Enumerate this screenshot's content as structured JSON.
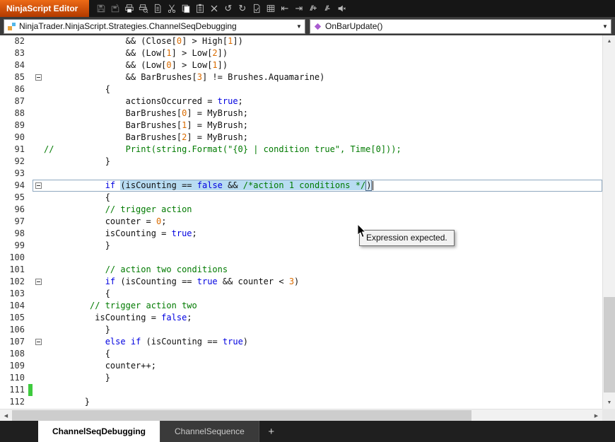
{
  "window": {
    "title": "NinjaScript Editor"
  },
  "toolbar": {
    "icons": [
      {
        "name": "save-icon",
        "disabled": true
      },
      {
        "name": "save-as-icon",
        "disabled": true
      },
      {
        "name": "print-icon",
        "disabled": false
      },
      {
        "name": "print-preview-icon",
        "disabled": false
      },
      {
        "name": "page-setup-icon",
        "disabled": false
      },
      {
        "name": "cut-icon",
        "disabled": false
      },
      {
        "name": "copy-icon",
        "disabled": false
      },
      {
        "name": "paste-icon",
        "disabled": false
      },
      {
        "name": "close-icon",
        "disabled": false
      },
      {
        "name": "undo-icon",
        "disabled": false
      },
      {
        "name": "redo-icon",
        "disabled": false
      },
      {
        "name": "compile-icon",
        "disabled": false
      },
      {
        "name": "compile-errors-icon",
        "disabled": false
      },
      {
        "name": "outdent-icon",
        "disabled": false
      },
      {
        "name": "indent-icon",
        "disabled": false
      },
      {
        "name": "comment-selection-icon",
        "disabled": false
      },
      {
        "name": "uncomment-selection-icon",
        "disabled": false
      },
      {
        "name": "mute-icon",
        "disabled": false
      }
    ]
  },
  "navbar": {
    "class_selector": "NinjaTrader.NinjaScript.Strategies.ChannelSeqDebugging",
    "method_selector": "OnBarUpdate()"
  },
  "editor": {
    "tooltip": "Expression expected.",
    "lines": [
      {
        "num": 82,
        "tokens": [
          [
            "pl",
            "                && (Close["
          ],
          [
            "num",
            "0"
          ],
          [
            "pl",
            "] > High["
          ],
          [
            "num",
            "1"
          ],
          [
            "pl",
            "])"
          ]
        ]
      },
      {
        "num": 83,
        "tokens": [
          [
            "pl",
            "                && (Low["
          ],
          [
            "num",
            "1"
          ],
          [
            "pl",
            "] > Low["
          ],
          [
            "num",
            "2"
          ],
          [
            "pl",
            "])"
          ]
        ]
      },
      {
        "num": 84,
        "tokens": [
          [
            "pl",
            "                && (Low["
          ],
          [
            "num",
            "0"
          ],
          [
            "pl",
            "] > Low["
          ],
          [
            "num",
            "1"
          ],
          [
            "pl",
            "])"
          ]
        ]
      },
      {
        "num": 85,
        "fold": true,
        "tokens": [
          [
            "pl",
            "                && BarBrushes["
          ],
          [
            "num",
            "3"
          ],
          [
            "pl",
            "] != Brushes.Aquamarine)"
          ]
        ]
      },
      {
        "num": 86,
        "tokens": [
          [
            "pl",
            "            {"
          ]
        ]
      },
      {
        "num": 87,
        "tokens": [
          [
            "pl",
            "                actionsOccurred = "
          ],
          [
            "kw",
            "true"
          ],
          [
            "pl",
            ";"
          ]
        ]
      },
      {
        "num": 88,
        "tokens": [
          [
            "pl",
            "                BarBrushes["
          ],
          [
            "num",
            "0"
          ],
          [
            "pl",
            "] = MyBrush;"
          ]
        ]
      },
      {
        "num": 89,
        "tokens": [
          [
            "pl",
            "                BarBrushes["
          ],
          [
            "num",
            "1"
          ],
          [
            "pl",
            "] = MyBrush;"
          ]
        ]
      },
      {
        "num": 90,
        "tokens": [
          [
            "pl",
            "                BarBrushes["
          ],
          [
            "num",
            "2"
          ],
          [
            "pl",
            "] = MyBrush;"
          ]
        ]
      },
      {
        "num": 91,
        "tokens": [
          [
            "cm",
            "//              Print(string.Format(\"{0} | condition true\", Time[0]));"
          ]
        ]
      },
      {
        "num": 92,
        "tokens": [
          [
            "pl",
            "            }"
          ]
        ]
      },
      {
        "num": 93,
        "tokens": []
      },
      {
        "num": 94,
        "fold": true,
        "current": true,
        "caret": true,
        "tokens": [
          [
            "pl",
            "            "
          ],
          [
            "kw",
            "if"
          ],
          [
            "pl",
            " "
          ],
          [
            "pl sel",
            "(isCounting == "
          ],
          [
            "kw sel",
            "false"
          ],
          [
            "pl sel",
            " && "
          ],
          [
            "cm sel",
            "/*action 1 conditions */"
          ],
          [
            "pl brace",
            ")"
          ]
        ]
      },
      {
        "num": 95,
        "tokens": [
          [
            "pl",
            "            {"
          ]
        ]
      },
      {
        "num": 96,
        "tokens": [
          [
            "cm",
            "            // trigger action"
          ]
        ]
      },
      {
        "num": 97,
        "tokens": [
          [
            "pl",
            "            counter = "
          ],
          [
            "num",
            "0"
          ],
          [
            "pl",
            ";"
          ]
        ]
      },
      {
        "num": 98,
        "tokens": [
          [
            "pl",
            "            isCounting = "
          ],
          [
            "kw",
            "true"
          ],
          [
            "pl",
            ";"
          ]
        ]
      },
      {
        "num": 99,
        "tokens": [
          [
            "pl",
            "            }"
          ]
        ]
      },
      {
        "num": 100,
        "tokens": []
      },
      {
        "num": 101,
        "tokens": [
          [
            "cm",
            "            // action two conditions"
          ]
        ]
      },
      {
        "num": 102,
        "fold": true,
        "tokens": [
          [
            "pl",
            "            "
          ],
          [
            "kw",
            "if"
          ],
          [
            "pl",
            " (isCounting == "
          ],
          [
            "kw",
            "true"
          ],
          [
            "pl",
            " && counter < "
          ],
          [
            "num",
            "3"
          ],
          [
            "pl",
            ")"
          ]
        ]
      },
      {
        "num": 103,
        "tokens": [
          [
            "pl",
            "            {"
          ]
        ]
      },
      {
        "num": 104,
        "tokens": [
          [
            "cm",
            "         // trigger action two"
          ]
        ]
      },
      {
        "num": 105,
        "tokens": [
          [
            "pl",
            "          isCounting = "
          ],
          [
            "kw",
            "false"
          ],
          [
            "pl",
            ";"
          ]
        ]
      },
      {
        "num": 106,
        "tokens": [
          [
            "pl",
            "            }"
          ]
        ]
      },
      {
        "num": 107,
        "fold": true,
        "tokens": [
          [
            "pl",
            "            "
          ],
          [
            "kw",
            "else"
          ],
          [
            "pl",
            " "
          ],
          [
            "kw",
            "if"
          ],
          [
            "pl",
            " (isCounting == "
          ],
          [
            "kw",
            "true"
          ],
          [
            "pl",
            ")"
          ]
        ]
      },
      {
        "num": 108,
        "tokens": [
          [
            "pl",
            "            {"
          ]
        ]
      },
      {
        "num": 109,
        "tokens": [
          [
            "pl",
            "            counter++;"
          ]
        ]
      },
      {
        "num": 110,
        "tokens": [
          [
            "pl",
            "            }"
          ]
        ]
      },
      {
        "num": 111,
        "changed": true,
        "tokens": []
      },
      {
        "num": 112,
        "tokens": [
          [
            "pl",
            "        }"
          ]
        ]
      }
    ]
  },
  "bottom_tabs": {
    "tabs": [
      {
        "label": "ChannelSeqDebugging",
        "active": true
      },
      {
        "label": "ChannelSequence",
        "active": false
      }
    ],
    "add_label": "+"
  }
}
